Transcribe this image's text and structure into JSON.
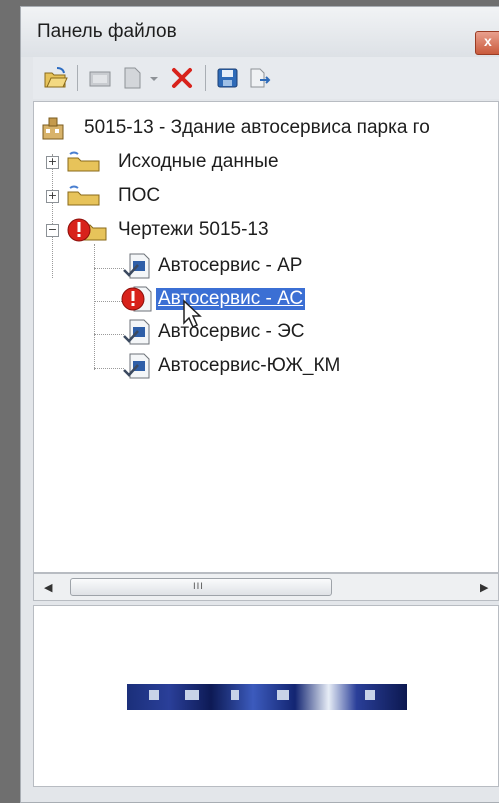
{
  "panel": {
    "title": "Панель файлов"
  },
  "toolbar": {
    "buttons": [
      {
        "icon": "open-folder-icon"
      },
      {
        "icon": "new-folder-icon"
      },
      {
        "icon": "new-document-icon"
      },
      {
        "icon": "dropdown-arrow-icon"
      },
      {
        "icon": "delete-icon",
        "color": "#d8221b"
      },
      {
        "icon": "save-icon"
      },
      {
        "icon": "export-icon"
      }
    ]
  },
  "tree": {
    "project": "5015-13 - Здание автосервиса парка го",
    "folders": [
      {
        "label": "Исходные данные",
        "expander": "+"
      },
      {
        "label": "ПОС",
        "expander": "+"
      },
      {
        "label": "Чертежи 5015-13",
        "expander": "−",
        "status": "error"
      }
    ],
    "documents": [
      {
        "label": "Автосервис - АР",
        "status": "ok"
      },
      {
        "label": "Автосервис - АС",
        "status": "error",
        "selected": true
      },
      {
        "label": "Автосервис - ЭС",
        "status": "ok"
      },
      {
        "label": "Автосервис-ЮЖ_КМ",
        "status": "ok"
      }
    ]
  },
  "scrollbar": {
    "left_arrow": "◀",
    "right_arrow": "▶",
    "grip": "III"
  },
  "colors": {
    "selection": "#3b6fd4",
    "error": "#d8221b",
    "folder": "#e7c35a"
  }
}
